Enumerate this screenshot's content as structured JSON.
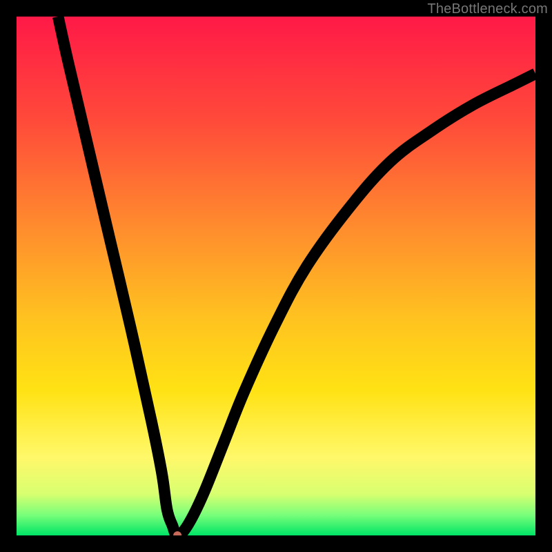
{
  "watermark": "TheBottleneck.com",
  "chart_data": {
    "type": "line",
    "title": "",
    "xlabel": "",
    "ylabel": "",
    "xlim": [
      0,
      100
    ],
    "ylim": [
      0,
      100
    ],
    "grid": false,
    "notes": "V-shaped bottleneck curve over a vertical red→yellow→green gradient. No axis ticks or labels are rendered. Values are estimated from pixel positions normalized to 0–100 on each axis.",
    "series": [
      {
        "name": "bottleneck-curve",
        "x": [
          8,
          10,
          14,
          18,
          22,
          26,
          28,
          29,
          30,
          31,
          33,
          36,
          40,
          44,
          50,
          56,
          64,
          72,
          80,
          88,
          96,
          100
        ],
        "y": [
          100,
          91,
          74,
          57,
          40,
          22,
          12,
          5,
          2,
          0,
          2,
          8,
          18,
          28,
          41,
          52,
          63,
          72,
          78,
          83,
          87,
          89
        ]
      }
    ],
    "marker": {
      "x": 31,
      "y": 0,
      "r": 0.8
    },
    "gradient_stops": [
      {
        "offset": 0.0,
        "color": "#ff1947"
      },
      {
        "offset": 0.2,
        "color": "#ff4a3a"
      },
      {
        "offset": 0.4,
        "color": "#ff8a2e"
      },
      {
        "offset": 0.58,
        "color": "#ffc220"
      },
      {
        "offset": 0.72,
        "color": "#ffe214"
      },
      {
        "offset": 0.85,
        "color": "#fff86a"
      },
      {
        "offset": 0.92,
        "color": "#d8ff70"
      },
      {
        "offset": 0.96,
        "color": "#7aff7a"
      },
      {
        "offset": 1.0,
        "color": "#00e466"
      }
    ]
  }
}
